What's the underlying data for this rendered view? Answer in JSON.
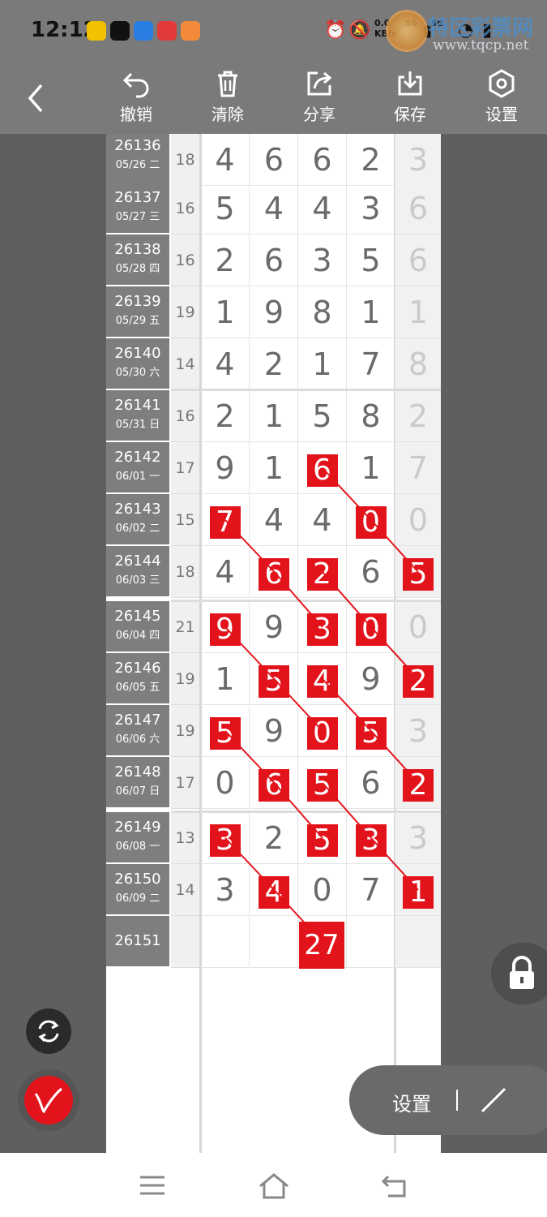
{
  "status": {
    "time": "12:12",
    "net_speed": "0.0\nKB/s",
    "signal_a": "5G",
    "signal_b": "5G",
    "watermark_title": "特区彩票网",
    "watermark_url": "www.tqcp.net"
  },
  "toolbar": {
    "undo_label": "撤销",
    "clear_label": "清除",
    "share_label": "分享",
    "save_label": "保存",
    "settings_label": "设置"
  },
  "rows": [
    {
      "issue": "26136",
      "date": "05/26 二",
      "sum": "18",
      "digits": [
        "4",
        "6",
        "6",
        "2"
      ],
      "extra": "3",
      "hl": []
    },
    {
      "issue": "26137",
      "date": "05/27 三",
      "sum": "16",
      "digits": [
        "5",
        "4",
        "4",
        "3"
      ],
      "extra": "6",
      "hl": []
    },
    {
      "issue": "26138",
      "date": "05/28 四",
      "sum": "16",
      "digits": [
        "2",
        "6",
        "3",
        "5"
      ],
      "extra": "6",
      "hl": []
    },
    {
      "issue": "26139",
      "date": "05/29 五",
      "sum": "19",
      "digits": [
        "1",
        "9",
        "8",
        "1"
      ],
      "extra": "1",
      "hl": []
    },
    {
      "issue": "26140",
      "date": "05/30 六",
      "sum": "14",
      "digits": [
        "4",
        "2",
        "1",
        "7"
      ],
      "extra": "8",
      "hl": []
    },
    {
      "issue": "26141",
      "date": "05/31 日",
      "sum": "16",
      "digits": [
        "2",
        "1",
        "5",
        "8"
      ],
      "extra": "2",
      "hl": []
    },
    {
      "issue": "26142",
      "date": "06/01 一",
      "sum": "17",
      "digits": [
        "9",
        "1",
        "6",
        "1"
      ],
      "extra": "7",
      "hl": [
        2
      ]
    },
    {
      "issue": "26143",
      "date": "06/02 二",
      "sum": "15",
      "digits": [
        "7",
        "4",
        "4",
        "0"
      ],
      "extra": "0",
      "hl": [
        0,
        3
      ]
    },
    {
      "issue": "26144",
      "date": "06/03 三",
      "sum": "18",
      "digits": [
        "4",
        "6",
        "2",
        "6"
      ],
      "extra": "5",
      "hl": [
        1,
        2,
        4
      ]
    },
    {
      "issue": "26145",
      "date": "06/04 四",
      "sum": "21",
      "digits": [
        "9",
        "9",
        "3",
        "0"
      ],
      "extra": "0",
      "hl": [
        0,
        2,
        3
      ]
    },
    {
      "issue": "26146",
      "date": "06/05 五",
      "sum": "19",
      "digits": [
        "1",
        "5",
        "4",
        "9"
      ],
      "extra": "2",
      "hl": [
        1,
        2,
        4
      ]
    },
    {
      "issue": "26147",
      "date": "06/06 六",
      "sum": "19",
      "digits": [
        "5",
        "9",
        "0",
        "5"
      ],
      "extra": "3",
      "hl": [
        0,
        2,
        3
      ]
    },
    {
      "issue": "26148",
      "date": "06/07 日",
      "sum": "17",
      "digits": [
        "0",
        "6",
        "5",
        "6"
      ],
      "extra": "2",
      "hl": [
        1,
        2,
        4
      ]
    },
    {
      "issue": "26149",
      "date": "06/08 一",
      "sum": "13",
      "digits": [
        "3",
        "2",
        "5",
        "3"
      ],
      "extra": "3",
      "hl": [
        0,
        2,
        3
      ]
    },
    {
      "issue": "26150",
      "date": "06/09 二",
      "sum": "14",
      "digits": [
        "3",
        "4",
        "0",
        "7"
      ],
      "extra": "1",
      "hl": [
        1,
        4
      ]
    },
    {
      "issue": "26151",
      "date": "",
      "sum": "",
      "digits": [
        "",
        "",
        "",
        ""
      ],
      "extra": "",
      "hl": []
    }
  ],
  "prediction": "27",
  "settings_pill_label": "设置",
  "colors": {
    "accent": "#e3131b",
    "toolbar": "#7a7a7a",
    "issue_cell": "#7e7e7e"
  }
}
